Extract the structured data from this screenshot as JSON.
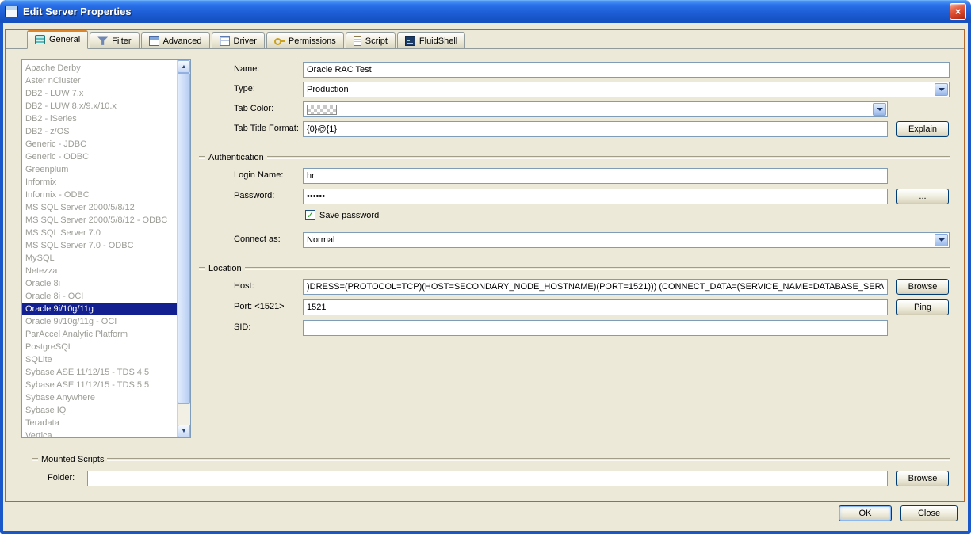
{
  "window": {
    "title": "Edit Server Properties"
  },
  "icons": {
    "close": "×",
    "check": "✓",
    "scroll_up": "▲",
    "scroll_down": "▼"
  },
  "tabs": [
    {
      "id": "general",
      "label": "General",
      "selected": true
    },
    {
      "id": "filter",
      "label": "Filter",
      "selected": false
    },
    {
      "id": "advanced",
      "label": "Advanced",
      "selected": false
    },
    {
      "id": "driver",
      "label": "Driver",
      "selected": false
    },
    {
      "id": "permissions",
      "label": "Permissions",
      "selected": false
    },
    {
      "id": "script",
      "label": "Script",
      "selected": false
    },
    {
      "id": "fluidshell",
      "label": "FluidShell",
      "selected": false
    }
  ],
  "server_list": {
    "selected": "Oracle 9i/10g/11g",
    "items": [
      "Apache Derby",
      "Aster nCluster",
      "DB2 - LUW 7.x",
      "DB2 - LUW 8.x/9.x/10.x",
      "DB2 - iSeries",
      "DB2 - z/OS",
      "Generic - JDBC",
      "Generic - ODBC",
      "Greenplum",
      "Informix",
      "Informix - ODBC",
      "MS SQL Server 2000/5/8/12",
      "MS SQL Server 2000/5/8/12 - ODBC",
      "MS SQL Server 7.0",
      "MS SQL Server 7.0 - ODBC",
      "MySQL",
      "Netezza",
      "Oracle 8i",
      "Oracle 8i - OCI",
      "Oracle 9i/10g/11g",
      "Oracle 9i/10g/11g - OCI",
      "ParAccel Analytic Platform",
      "PostgreSQL",
      "SQLite",
      "Sybase ASE 11/12/15 - TDS 4.5",
      "Sybase ASE 11/12/15 - TDS 5.5",
      "Sybase Anywhere",
      "Sybase IQ",
      "Teradata",
      "Vertica"
    ]
  },
  "form": {
    "name": {
      "label": "Name:",
      "value": "Oracle RAC Test"
    },
    "type": {
      "label": "Type:",
      "value": "Production"
    },
    "tab_color": {
      "label": "Tab Color:"
    },
    "tab_title_format": {
      "label": "Tab Title Format:",
      "value": "{0}@{1}",
      "button": "Explain"
    },
    "authentication": {
      "title": "Authentication",
      "login_name": {
        "label": "Login Name:",
        "value": "hr"
      },
      "password": {
        "label": "Password:",
        "value": "••••••",
        "button": "..."
      },
      "save_password": {
        "label": "Save password",
        "checked": true
      },
      "connect_as": {
        "label": "Connect as:",
        "value": "Normal"
      }
    },
    "location": {
      "title": "Location",
      "host": {
        "label": "Host:",
        "value": ")DRESS=(PROTOCOL=TCP)(HOST=SECONDARY_NODE_HOSTNAME)(PORT=1521))) (CONNECT_DATA=(SERVICE_NAME=DATABASE_SERVICENAME)))",
        "button": "Browse"
      },
      "port": {
        "label": "Port: <1521>",
        "value": "1521",
        "button": "Ping"
      },
      "sid": {
        "label": "SID:",
        "value": ""
      }
    },
    "mounted_scripts": {
      "title": "Mounted Scripts",
      "folder": {
        "label": "Folder:",
        "value": "",
        "button": "Browse"
      }
    }
  },
  "footer": {
    "ok": "OK",
    "close": "Close"
  }
}
